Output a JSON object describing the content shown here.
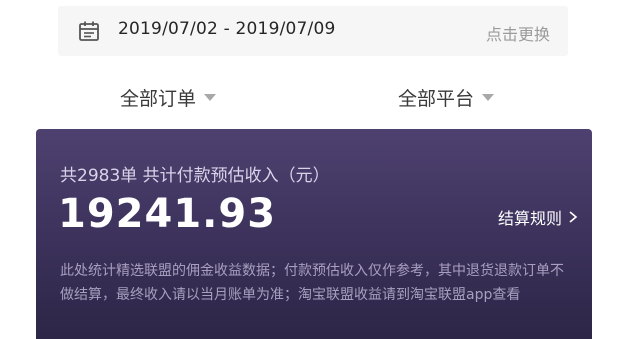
{
  "date_range": {
    "value": "2019/07/02 - 2019/07/09",
    "change_label": "点击更换"
  },
  "filters": {
    "orders_label": "全部订单",
    "platforms_label": "全部平台"
  },
  "summary_card": {
    "summary_text": "共2983单 共计付款预估收入（元）",
    "amount": "19241.93",
    "rules_label": "结算规则",
    "note": "此处统计精选联盟的佣金收益数据；付款预估收入仅作参考，其中退货退款订单不做结算，最终收入请以当月账单为准；淘宝联盟收益请到淘宝联盟app查看"
  },
  "colors": {
    "card_top": "#4e4170",
    "card_bottom": "#2d2647",
    "muted_text": "#9b9b9b"
  }
}
